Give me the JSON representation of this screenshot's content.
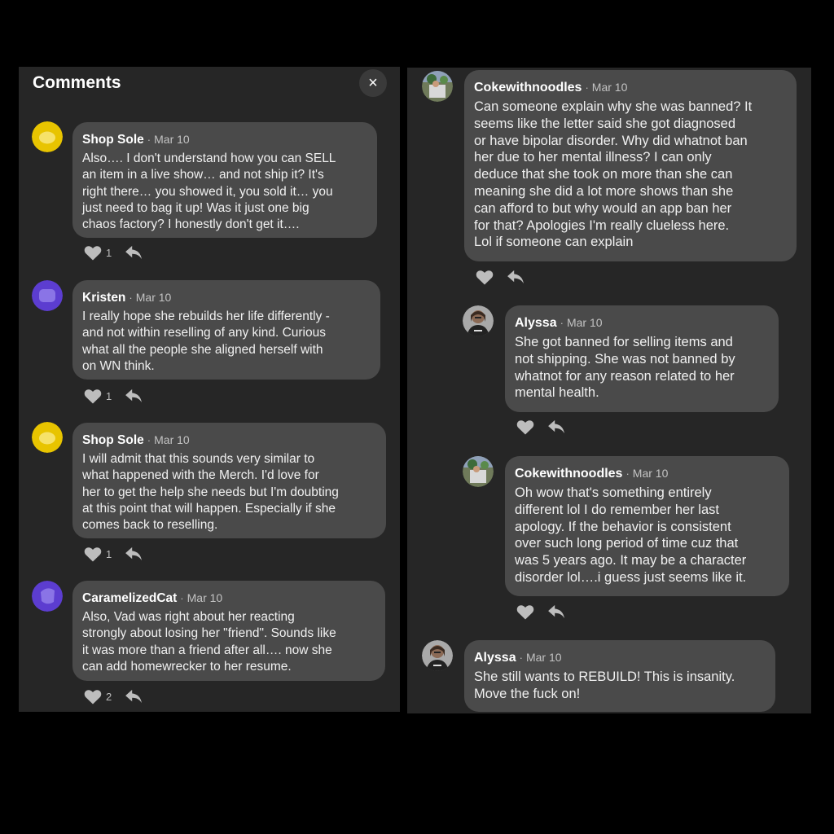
{
  "colors": {
    "page_bg": "#000000",
    "panel_bg": "#262626",
    "bubble_bg": "#4a4a4a",
    "avatar_yellow": "#e8c400",
    "avatar_purple": "#5c3dd0"
  },
  "header": {
    "title": "Comments",
    "close_icon": "×"
  },
  "left_comments": [
    {
      "author": "Shop Sole",
      "date": "Mar 10",
      "avatar_icon": "yellow-blob-avatar",
      "text": "Also…. I don't understand how you can SELL\nan item in a live show… and not ship it?  It's\nright there… you showed it, you sold it… you\njust need to bag it up!  Was it just one big\nchaos factory?  I honestly don't get it….",
      "likes": "1"
    },
    {
      "author": "Kristen",
      "date": "Mar 10",
      "avatar_icon": "purple-blob-avatar",
      "text": "I really hope she rebuilds her life differently -\nand not within reselling of any kind. Curious\nwhat all the people she aligned herself with\non WN think.",
      "likes": "1"
    },
    {
      "author": "Shop Sole",
      "date": "Mar 10",
      "avatar_icon": "yellow-blob-avatar",
      "text": "I will admit that this sounds very similar to\nwhat happened with the Merch.  I'd love for\nher to get the help she needs but I'm doubting\nat this point that will happen.  Especially if she\ncomes back to reselling.",
      "likes": "1"
    },
    {
      "author": "CaramelizedCat",
      "date": "Mar 10",
      "avatar_icon": "purple-blob-avatar",
      "text": "Also, Vad was right about her reacting\nstrongly about losing her \"friend\". Sounds like\nit was more than a friend after all…. now she\ncan add homewrecker to her resume.",
      "likes": "2"
    }
  ],
  "right_comments": [
    {
      "author": "Cokewithnoodles",
      "date": "Mar 10",
      "avatar_icon": "photo-avatar-outdoor",
      "text": "Can someone explain why she was banned? It\nseems like the letter said she got diagnosed\nor have bipolar disorder. Why did whatnot ban\nher due to her mental illness? I can only\ndeduce that she took on more than she can\nmeaning she did a lot more shows than she\ncan afford to but why would an app ban her\nfor that? Apologies I'm really clueless here.\nLol if someone can explain"
    },
    {
      "author": "Alyssa",
      "date": "Mar 10",
      "avatar_icon": "photo-avatar-person",
      "text": "She got banned for selling items and\nnot shipping. She was not banned by\nwhatnot for any reason related to her\nmental health."
    },
    {
      "author": "Cokewithnoodles",
      "date": "Mar 10",
      "avatar_icon": "photo-avatar-outdoor",
      "text": "Oh wow that's something entirely\ndifferent lol I do remember her last\napology. If the behavior is consistent\nover such long period of time cuz that\nwas 5 years ago. It may be a character\ndisorder lol….i guess just seems like it."
    },
    {
      "author": "Alyssa",
      "date": "Mar 10",
      "avatar_icon": "photo-avatar-person",
      "text": "She still wants to REBUILD! This is insanity.\nMove the fuck on!"
    }
  ],
  "icons": {
    "like": "heart-icon",
    "reply": "reply-arrow-icon"
  }
}
